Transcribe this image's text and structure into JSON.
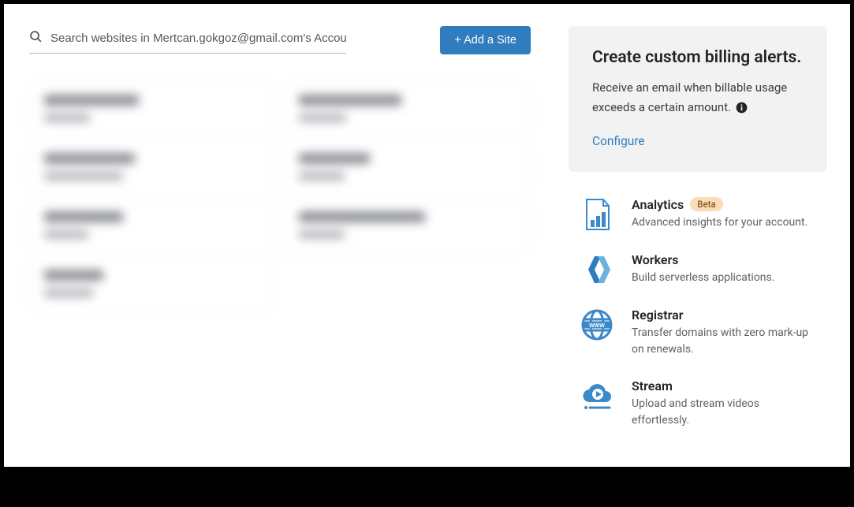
{
  "search": {
    "placeholder": "Search websites in Mertcan.gokgoz@gmail.com's Account.."
  },
  "add_site_label": "+ Add a Site",
  "alert": {
    "title": "Create custom billing alerts.",
    "body": "Receive an email when billable usage exceeds a certain amount.",
    "configure": "Configure"
  },
  "products": [
    {
      "id": "analytics",
      "title": "Analytics",
      "badge": "Beta",
      "desc": "Advanced insights for your account."
    },
    {
      "id": "workers",
      "title": "Workers",
      "badge": null,
      "desc": "Build serverless applications."
    },
    {
      "id": "registrar",
      "title": "Registrar",
      "badge": null,
      "desc": "Transfer domains with zero mark-up on renewals."
    },
    {
      "id": "stream",
      "title": "Stream",
      "badge": null,
      "desc": "Upload and stream videos effortlessly."
    }
  ],
  "colors": {
    "accent": "#2f7cbe",
    "icon": "#3b89c9",
    "badge_bg": "#f9dcb8",
    "badge_fg": "#8a5a1f"
  }
}
